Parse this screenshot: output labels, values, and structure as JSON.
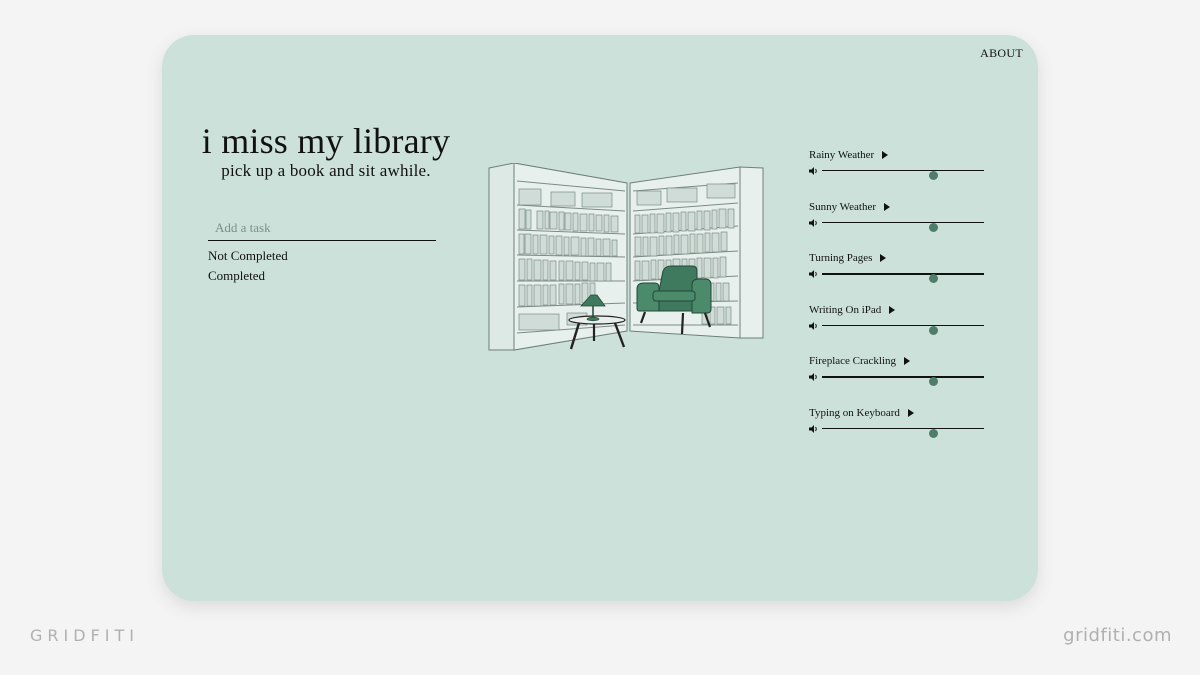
{
  "nav": {
    "about_label": "ABOUT"
  },
  "header": {
    "title": "i miss my library",
    "subtitle": "pick up a book and sit awhile."
  },
  "tasks": {
    "input_placeholder": "Add a task",
    "input_value": "",
    "filters": [
      "Not Completed",
      "Completed"
    ]
  },
  "sounds": [
    {
      "name": "Rainy Weather",
      "volume": 0.69
    },
    {
      "name": "Sunny Weather",
      "volume": 0.69
    },
    {
      "name": "Turning Pages",
      "volume": 0.69
    },
    {
      "name": "Writing On iPad",
      "volume": 0.69
    },
    {
      "name": "Fireplace Crackling",
      "volume": 0.69
    },
    {
      "name": "Typing on Keyboard",
      "volume": 0.69
    }
  ],
  "footer": {
    "brand_left": "GRIDFITI",
    "brand_right": "gridfiti.com"
  },
  "colors": {
    "card_background": "#cde1db",
    "page_background": "#f4f4f4",
    "accent_green": "#4f7d69",
    "chair_green": "#3f7a5e"
  }
}
